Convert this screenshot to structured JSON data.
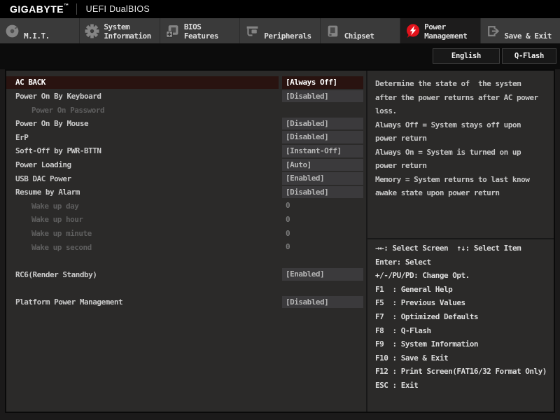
{
  "header": {
    "brand": "GIGABYTE",
    "trademark": "™",
    "product": "UEFI DualBIOS"
  },
  "tabbar": {
    "tabs": [
      {
        "label": "M.I.T.",
        "icon": "mit-dial-icon",
        "active": false
      },
      {
        "label": "System\nInformation",
        "icon": "system-information-gear-icon",
        "active": false
      },
      {
        "label": "BIOS\nFeatures",
        "icon": "bios-features-chip-plus-icon",
        "active": false
      },
      {
        "label": "Peripherals",
        "icon": "peripherals-device-icon",
        "active": false
      },
      {
        "label": "Chipset",
        "icon": "chipset-chip-icon",
        "active": false
      },
      {
        "label": "Power\nManagement",
        "icon": "power-management-bolt-icon",
        "active": true
      },
      {
        "label": "Save & Exit",
        "icon": "save-exit-door-icon",
        "active": false
      }
    ]
  },
  "topbar": {
    "language_button": "English",
    "qflash_button": "Q-Flash"
  },
  "settings": {
    "rows": [
      {
        "label": "AC BACK",
        "value": "[Always Off]",
        "boxed": true,
        "selected": true
      },
      {
        "label": "Power On By Keyboard",
        "value": "[Disabled]",
        "boxed": true
      },
      {
        "label": "Power On Password",
        "indent": true,
        "disabled": true
      },
      {
        "label": "Power On By Mouse",
        "value": "[Disabled]",
        "boxed": true
      },
      {
        "label": "ErP",
        "value": "[Disabled]",
        "boxed": true
      },
      {
        "label": "Soft-Off by PWR-BTTN",
        "value": "[Instant-Off]",
        "boxed": true
      },
      {
        "label": "Power Loading",
        "value": "[Auto]",
        "boxed": true
      },
      {
        "label": "USB DAC Power",
        "value": "[Enabled]",
        "boxed": true
      },
      {
        "label": "Resume by Alarm",
        "value": "[Disabled]",
        "boxed": true
      },
      {
        "label": "Wake up day",
        "value": "0",
        "indent": true,
        "disabled": true
      },
      {
        "label": "Wake up hour",
        "value": "0",
        "indent": true,
        "disabled": true
      },
      {
        "label": "Wake up minute",
        "value": "0",
        "indent": true,
        "disabled": true
      },
      {
        "label": "Wake up second",
        "value": "0",
        "indent": true,
        "disabled": true
      },
      {
        "spacer": true
      },
      {
        "label": "RC6(Render Standby)",
        "value": "[Enabled]",
        "boxed": true
      },
      {
        "spacer": true
      },
      {
        "label": "Platform Power Management",
        "value": "[Disabled]",
        "boxed": true
      }
    ]
  },
  "help": {
    "lines": [
      "Determine the state of  the system",
      "after the power returns after AC power",
      "loss.",
      "Always Off = System stays off upon",
      "power return",
      "Always On = System is turned on up",
      "power return",
      "Memory = System returns to last know",
      "awake state upon power return"
    ]
  },
  "hotkeys": {
    "lines": [
      "→←: Select Screen  ↑↓: Select Item",
      "Enter: Select",
      "+/-/PU/PD: Change Opt.",
      "F1  : General Help",
      "F5  : Previous Values",
      "F7  : Optimized Defaults",
      "F8  : Q-Flash",
      "F9  : System Information",
      "F10 : Save & Exit",
      "F12 : Print Screen(FAT16/32 Format Only)",
      "ESC : Exit"
    ]
  },
  "colors": {
    "accent_red": "#e2121b",
    "selected_row_bg": "#291310",
    "panel_bg": "#2b2a29",
    "value_box_bg": "#3b3a3c",
    "tab_bg": "#3a3a3a",
    "active_tab_bg": "#1d1c1c"
  }
}
